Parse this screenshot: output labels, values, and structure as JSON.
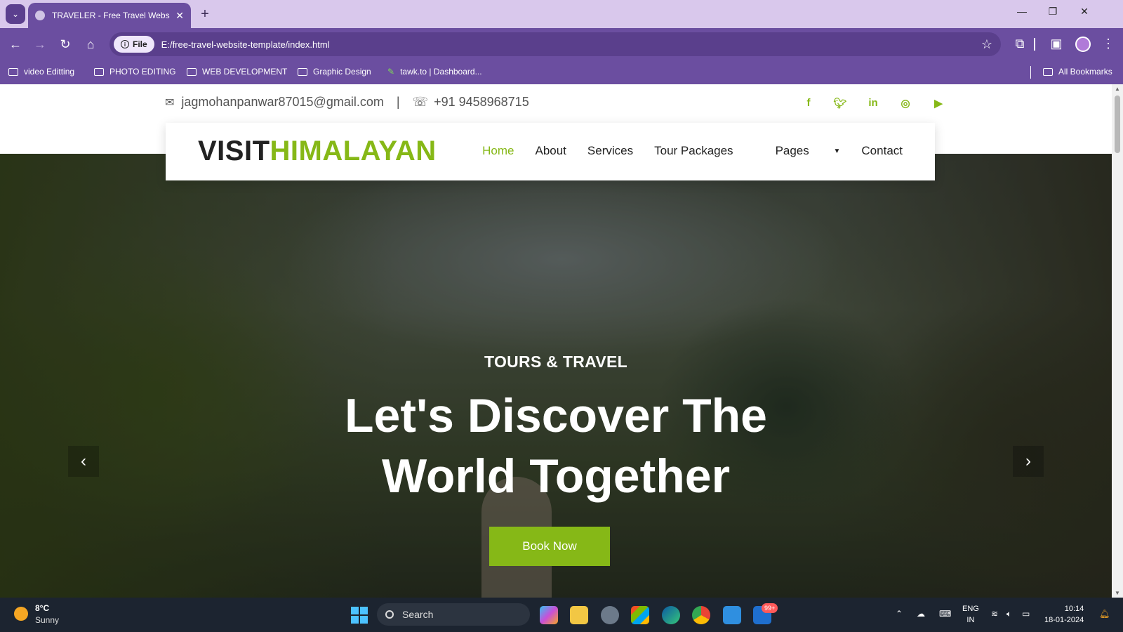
{
  "browser": {
    "tab_title": "TRAVELER - Free Travel Website",
    "file_chip": "File",
    "url": "E:/free-travel-website-template/index.html",
    "bookmarks": [
      "video Editting",
      "PHOTO EDITING",
      "WEB DEVELOPMENT",
      "Graphic Design",
      "tawk.to | Dashboard..."
    ],
    "all_bookmarks": "All Bookmarks"
  },
  "topbar": {
    "email": "jagmohanpanwar87015@gmail.com",
    "separator": "|",
    "phone": "+91 9458968715",
    "social_icons": [
      "facebook-icon",
      "twitter-icon",
      "linkedin-icon",
      "instagram-icon",
      "youtube-icon"
    ]
  },
  "navbar": {
    "brand_part1": "VISIT",
    "brand_part2": "HIMALAYAN",
    "items": [
      "Home",
      "About",
      "Services",
      "Tour Packages",
      "Pages",
      "Contact"
    ],
    "active": "Home"
  },
  "hero": {
    "kicker": "TOURS & TRAVEL",
    "headline_line1": "Let's Discover The",
    "headline_line2": "World Together",
    "cta": "Book Now"
  },
  "taskbar": {
    "temperature": "8°C",
    "condition": "Sunny",
    "search_placeholder": "Search",
    "badge": "99+",
    "lang_line1": "ENG",
    "lang_line2": "IN",
    "time": "10:14",
    "date": "18-01-2024"
  },
  "colors": {
    "accent": "#86b817",
    "chrome": "#6b4ea0",
    "taskbar": "#1c2430"
  }
}
